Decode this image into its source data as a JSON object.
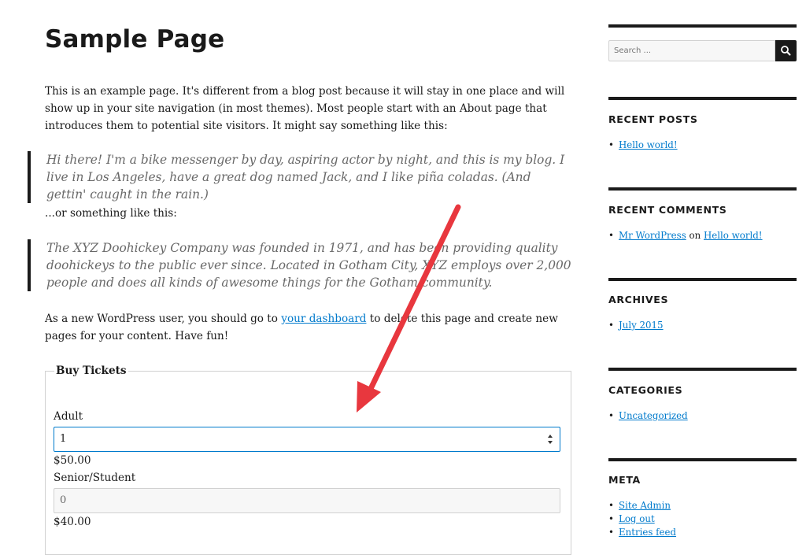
{
  "page": {
    "title": "Sample Page",
    "intro": "This is an example page. It's different from a blog post because it will stay in one place and will show up in your site navigation (in most themes). Most people start with an About page that introduces them to potential site visitors. It might say something like this:",
    "quote1": "Hi there! I'm a bike messenger by day, aspiring actor by night, and this is my blog. I live in Los Angeles, have a great dog named Jack, and I like piña coladas. (And gettin' caught in the rain.)",
    "or_text": "...or something like this:",
    "quote2": "The XYZ Doohickey Company was founded in 1971, and has been providing quality doohickeys to the public ever since. Located in Gotham City, XYZ employs over 2,000 people and does all kinds of awesome things for the Gotham community.",
    "closing_before": "As a new WordPress user, you should go to ",
    "closing_link": "your dashboard",
    "closing_after": " to delete this page and create new pages for your content. Have fun!"
  },
  "tickets": {
    "legend": "Buy Tickets",
    "adult_label": "Adult",
    "adult_value": "1",
    "adult_price": "$50.00",
    "senior_label": "Senior/Student",
    "senior_value": "0",
    "senior_price": "$40.00"
  },
  "sidebar": {
    "search_placeholder": "Search ...",
    "recent_posts_title": "RECENT POSTS",
    "recent_posts": [
      "Hello world!"
    ],
    "recent_comments_title": "RECENT COMMENTS",
    "comment_author": "Mr WordPress",
    "comment_on": " on ",
    "comment_post": "Hello world!",
    "archives_title": "ARCHIVES",
    "archives": [
      "July 2015"
    ],
    "categories_title": "CATEGORIES",
    "categories": [
      "Uncategorized"
    ],
    "meta_title": "META",
    "meta": [
      "Site Admin",
      "Log out",
      "Entries feed"
    ]
  },
  "icons": {
    "search": "search-icon",
    "spinner": "spinner-arrows-icon",
    "annotation": "red-arrow-icon"
  },
  "colors": {
    "link": "#007acc",
    "text": "#1a1a1a",
    "quote": "#686868",
    "arrow": "#e8373e"
  }
}
